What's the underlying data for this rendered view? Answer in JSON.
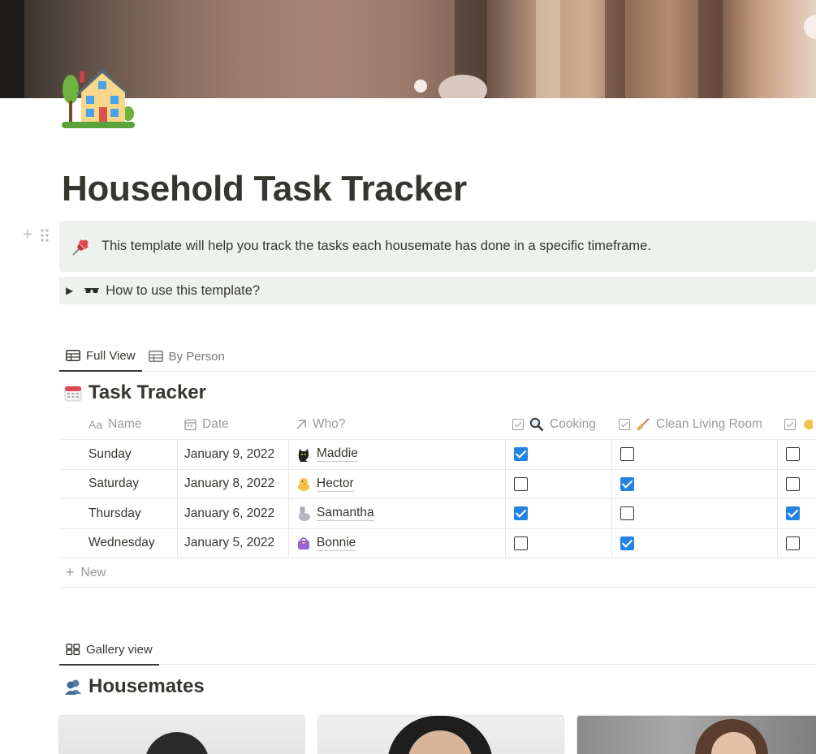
{
  "page": {
    "title": "Household Task Tracker",
    "icon": "house-icon"
  },
  "callout": {
    "icon": "pushpin-icon",
    "text": "This template will help you track the tasks each housemate has done in a specific timeframe."
  },
  "toggle": {
    "icon": "sunglasses-icon",
    "label": "How to use this template?"
  },
  "tabs": [
    {
      "label": "Full View",
      "icon": "table-icon",
      "active": true
    },
    {
      "label": "By Person",
      "icon": "table-icon",
      "active": false
    }
  ],
  "task_tracker": {
    "title": "Task Tracker",
    "icon": "calendar-icon",
    "columns": {
      "name": {
        "label": "Name",
        "icon": "Aa"
      },
      "date": {
        "label": "Date",
        "icon": "calendar-prop-icon"
      },
      "who": {
        "label": "Who?",
        "icon": "arrow-ne-icon"
      },
      "cooking": {
        "label": "Cooking",
        "icon": "magnifier-icon"
      },
      "clean": {
        "label": "Clean Living Room",
        "icon": "broom-icon"
      }
    },
    "rows": [
      {
        "name": "Sunday",
        "date": "January 9, 2022",
        "who": "Maddie",
        "avatar": "cat-icon",
        "cooking": true,
        "clean": false,
        "more": false
      },
      {
        "name": "Saturday",
        "date": "January 8, 2022",
        "who": "Hector",
        "avatar": "chick-icon",
        "cooking": false,
        "clean": true,
        "more": false
      },
      {
        "name": "Thursday",
        "date": "January 6, 2022",
        "who": "Samantha",
        "avatar": "rabbit-icon",
        "cooking": true,
        "clean": false,
        "more": true
      },
      {
        "name": "Wednesday",
        "date": "January 5, 2022",
        "who": "Bonnie",
        "avatar": "purse-icon",
        "cooking": false,
        "clean": true,
        "more": false
      }
    ],
    "new_label": "New"
  },
  "gallery": {
    "tab_label": "Gallery view",
    "title": "Housemates",
    "icon": "people-icon"
  },
  "colors": {
    "callout_bg": "#edf3ec",
    "checkbox_on": "#2383e2",
    "text": "#37352f",
    "muted": "#9b9a97"
  }
}
